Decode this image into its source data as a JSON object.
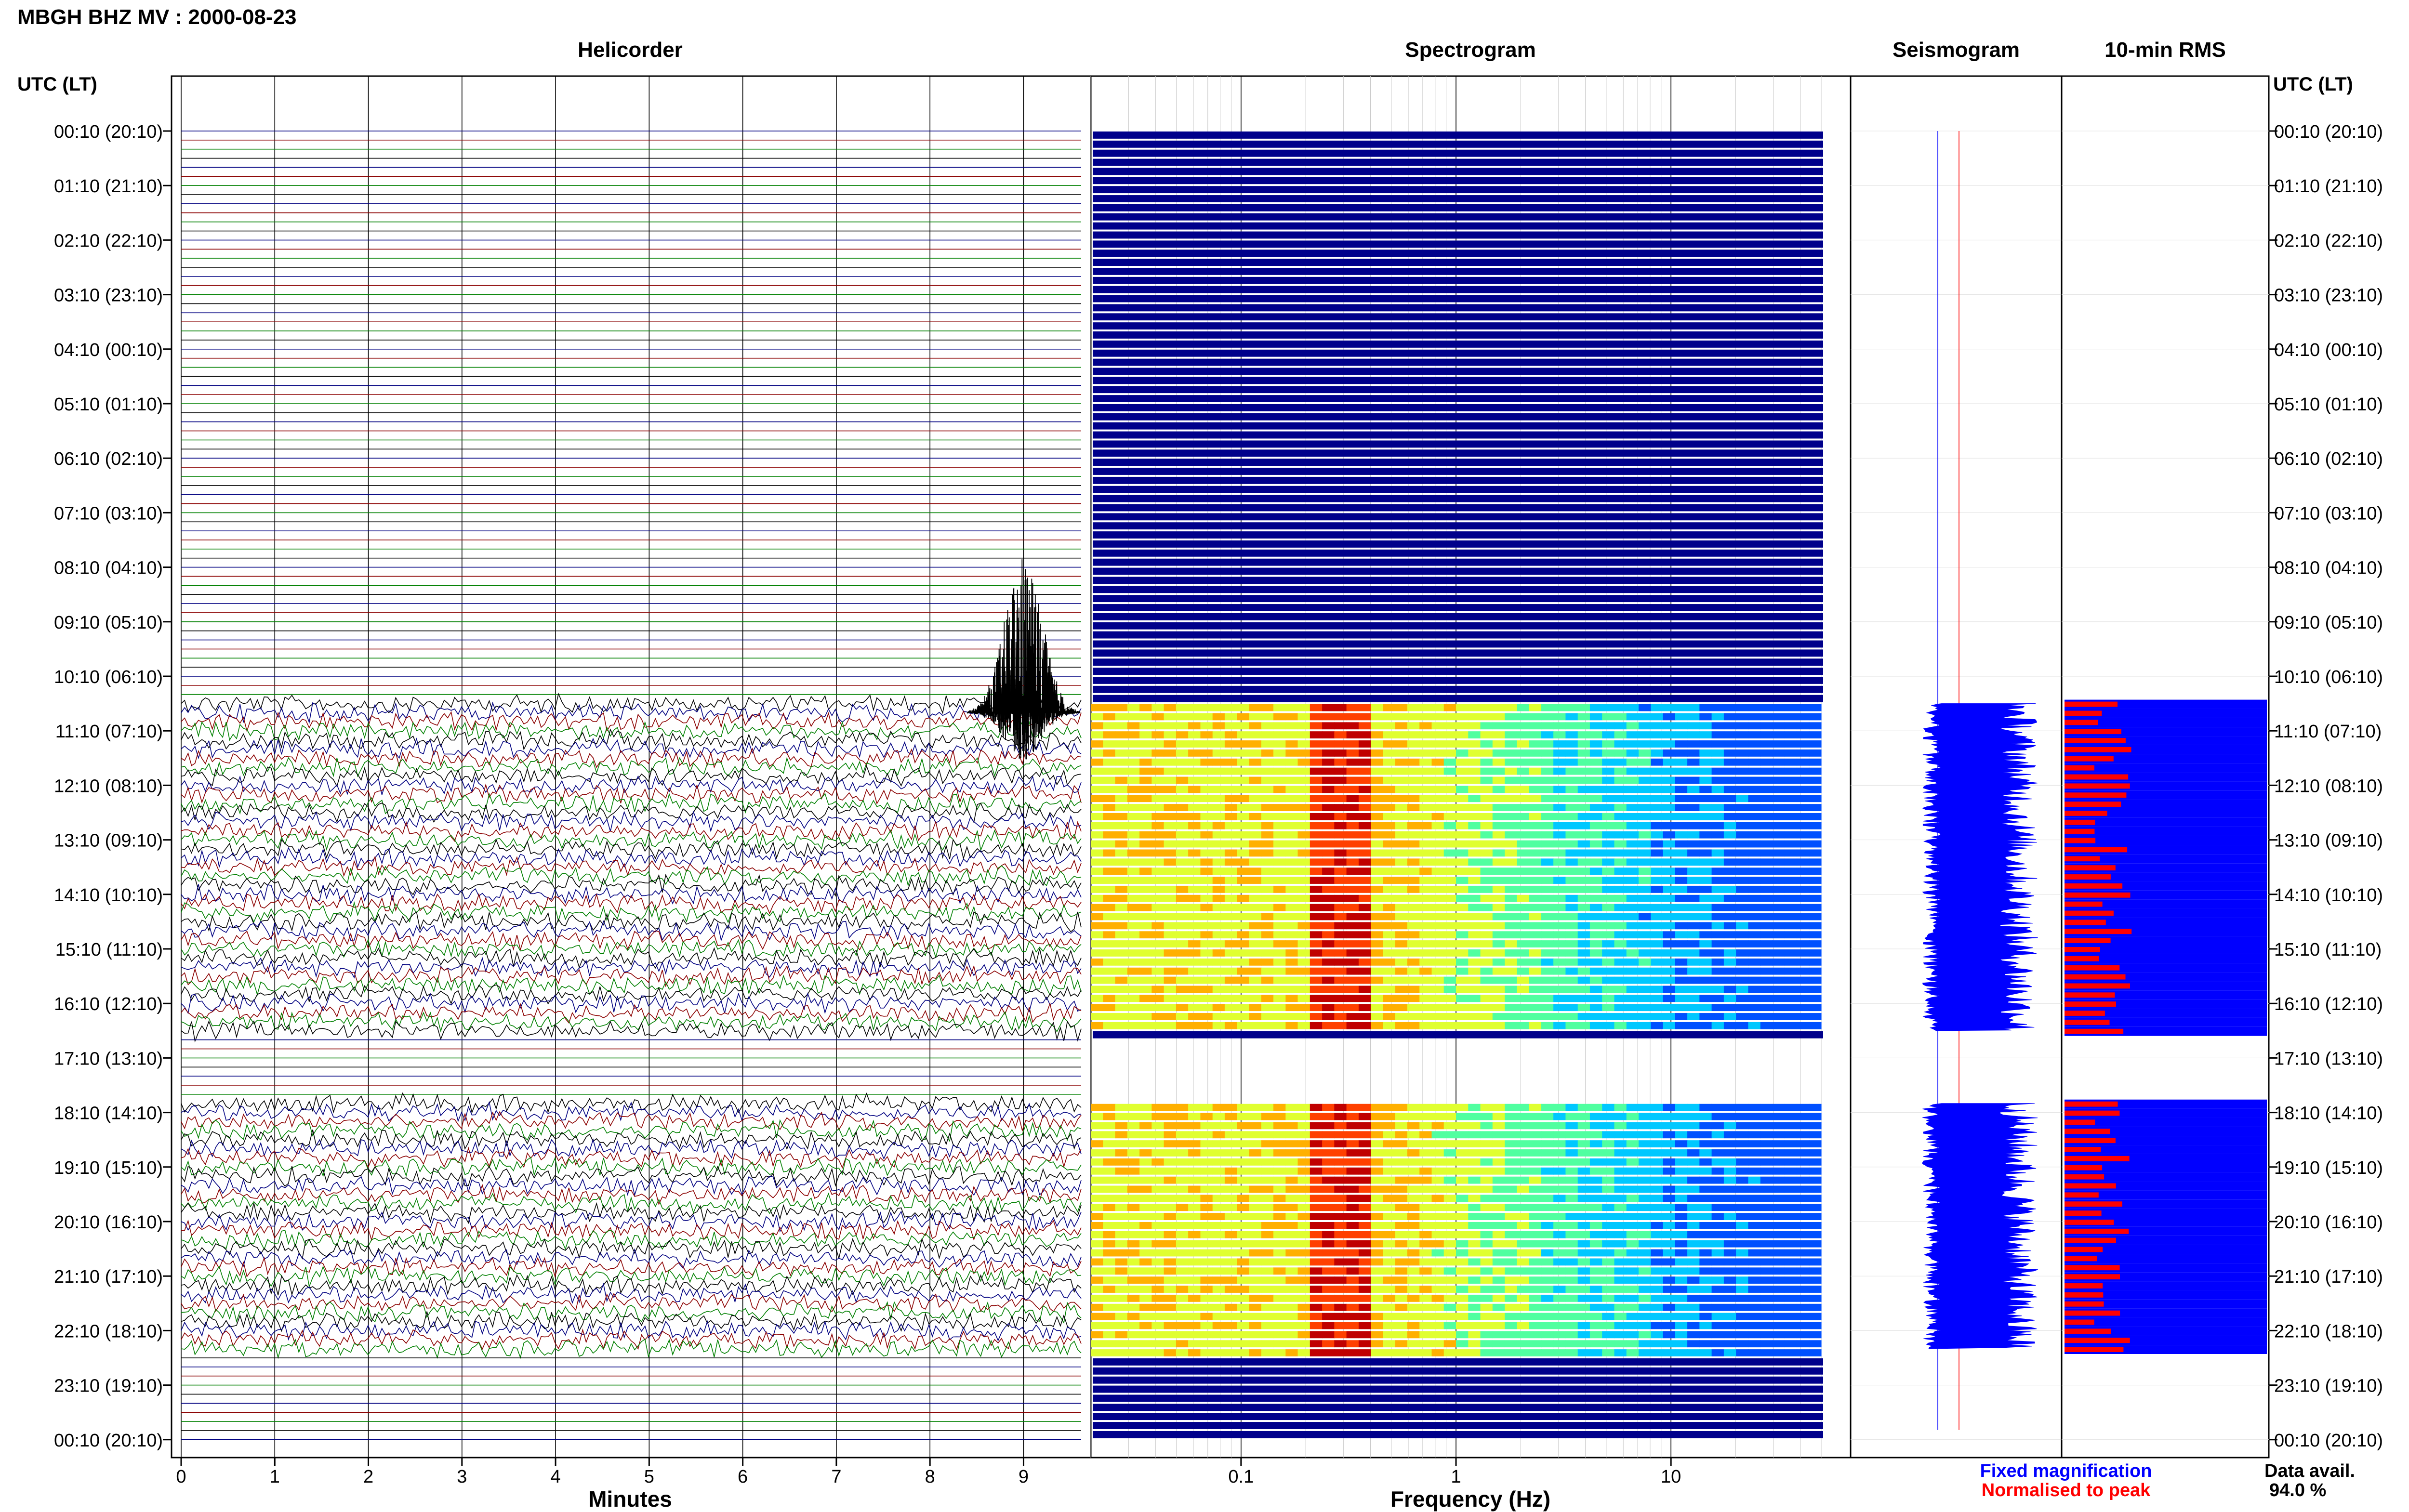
{
  "header": {
    "title": "MBGH BHZ MV : 2000-08-23"
  },
  "panels": {
    "helicorder": "Helicorder",
    "spectrogram": "Spectrogram",
    "seismogram": "Seismogram",
    "rms": "10-min RMS"
  },
  "time_axis": {
    "label": "UTC (LT)",
    "ticks": [
      "00:10 (20:10)",
      "01:10 (21:10)",
      "02:10 (22:10)",
      "03:10 (23:10)",
      "04:10 (00:10)",
      "05:10 (01:10)",
      "06:10 (02:10)",
      "07:10 (03:10)",
      "08:10 (04:10)",
      "09:10 (05:10)",
      "10:10 (06:10)",
      "11:10 (07:10)",
      "12:10 (08:10)",
      "13:10 (09:10)",
      "14:10 (10:10)",
      "15:10 (11:10)",
      "16:10 (12:10)",
      "17:10 (13:10)",
      "18:10 (14:10)",
      "19:10 (15:10)",
      "20:10 (16:10)",
      "21:10 (17:10)",
      "22:10 (18:10)",
      "23:10 (19:10)",
      "00:10 (20:10)"
    ]
  },
  "chart_data": [
    {
      "type": "line",
      "title": "Helicorder",
      "xlabel": "Minutes",
      "xticks": [
        "0",
        "1",
        "2",
        "3",
        "4",
        "5",
        "6",
        "7",
        "8",
        "9"
      ],
      "xlim": [
        0,
        10
      ],
      "data_rows": {
        "first_active_utc": "10:40",
        "gap_start_utc": "16:40",
        "gap_end_utc": "18:00",
        "last_active_utc": "22:30"
      },
      "trace_colors": [
        "#000080",
        "#8b0000",
        "#008000",
        "#000000"
      ],
      "large_event": {
        "minute": 9.0,
        "utc": "10:50"
      }
    },
    {
      "type": "heatmap",
      "title": "Spectrogram",
      "xlabel": "Frequency (Hz)",
      "xscale": "log",
      "xlim": [
        0.02,
        50
      ],
      "xticks": [
        "0.1",
        "1",
        "10"
      ],
      "peak_band_hz": [
        0.2,
        0.4
      ]
    },
    {
      "type": "bar",
      "title": "10-min RMS",
      "legend": [
        {
          "name": "Fixed magnification",
          "color": "#0000ff"
        },
        {
          "name": "Normalised to peak",
          "color": "#ff0000"
        }
      ],
      "data_availability_label": "Data avail.",
      "data_availability_value": "94.0 %"
    }
  ]
}
